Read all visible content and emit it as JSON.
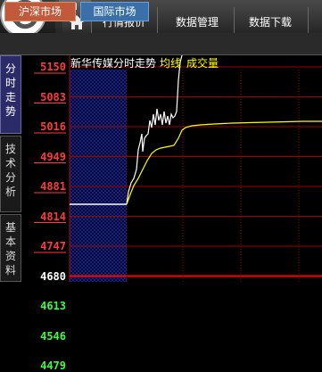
{
  "menu": {
    "items": [
      "行情报价",
      "数据管理",
      "数据下载"
    ]
  },
  "market_tabs": [
    "沪深市场",
    "国际市场"
  ],
  "side_tabs": [
    {
      "label": "分时走势",
      "active": true
    },
    {
      "label": "技术分析",
      "active": false
    },
    {
      "label": "基本资料",
      "active": false
    }
  ],
  "chart": {
    "title": "新华传媒分时走势",
    "avg_label": "均线",
    "vol_label": "成交量",
    "prices": [
      "5150",
      "5083",
      "5016",
      "4949",
      "4881",
      "4814",
      "4747",
      "4680",
      "4613",
      "4546",
      "4479"
    ],
    "ref_price": "4680"
  },
  "colors": {
    "up": "#ff3a3a",
    "down": "#3aff3a",
    "ref": "#ffffff",
    "price_line": "#ffffff",
    "avg_line": "#ffff00",
    "grid": "#a00000"
  }
}
